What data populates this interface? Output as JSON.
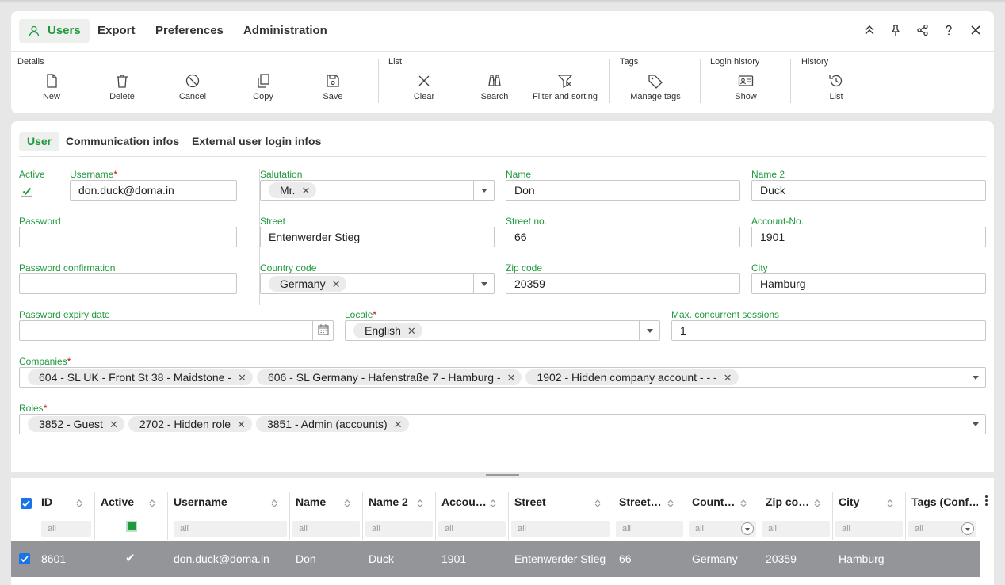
{
  "menu": {
    "items": [
      "Users",
      "Export",
      "Preferences",
      "Administration"
    ],
    "window_icons": [
      "collapse-up-icon",
      "pin-icon",
      "share-icon",
      "help-icon",
      "close-icon"
    ]
  },
  "toolbar": {
    "groups": {
      "details": "Details",
      "list": "List",
      "tags": "Tags",
      "login_history": "Login history",
      "history": "History"
    },
    "buttons": {
      "new": "New",
      "delete": "Delete",
      "cancel": "Cancel",
      "copy": "Copy",
      "save": "Save",
      "clear": "Clear",
      "search": "Search",
      "filter": "Filter and sorting",
      "manage_tags": "Manage tags",
      "show": "Show",
      "list": "List"
    }
  },
  "tabs": [
    "User",
    "Communication infos",
    "External user login infos"
  ],
  "form": {
    "active_label": "Active",
    "active_checked": true,
    "username_label": "Username",
    "username": "don.duck@doma.in",
    "password_label": "Password",
    "password": "",
    "password_confirm_label": "Password confirmation",
    "password_confirm": "",
    "salutation_label": "Salutation",
    "salutation": "Mr.",
    "name_label": "Name",
    "name": "Don",
    "name2_label": "Name 2",
    "name2": "Duck",
    "street_label": "Street",
    "street": "Entenwerder Stieg",
    "street_no_label": "Street no.",
    "street_no": "66",
    "account_no_label": "Account-No.",
    "account_no": "1901",
    "country_label": "Country code",
    "country": "Germany",
    "zip_label": "Zip code",
    "zip": "20359",
    "city_label": "City",
    "city": "Hamburg",
    "expiry_label": "Password expiry date",
    "expiry": "",
    "locale_label": "Locale",
    "locale": "English",
    "sessions_label": "Max. concurrent sessions",
    "sessions": "1",
    "companies_label": "Companies",
    "companies": [
      "604 - SL UK - Front St 38 - Maidstone -",
      "606 - SL Germany - Hafenstraße 7 - Hamburg -",
      "1902 - Hidden company account - - -"
    ],
    "roles_label": "Roles",
    "roles": [
      "3852 - Guest",
      "2702 - Hidden role",
      "3851 - Admin (accounts)"
    ],
    "required_mark": "*",
    "chip_remove": "✕"
  },
  "grid": {
    "columns": [
      "ID",
      "Active",
      "Username",
      "Name",
      "Name 2",
      "Accou…",
      "Street",
      "Street…",
      "Count…",
      "Zip co…",
      "City",
      "Tags (Conf…"
    ],
    "filter_placeholder": "all",
    "row": {
      "checked": true,
      "id": "8601",
      "active": "✔",
      "username": "don.duck@doma.in",
      "name": "Don",
      "name2": "Duck",
      "account": "1901",
      "street": "Entenwerder Stieg",
      "street_no": "66",
      "country": "Germany",
      "zip": "20359",
      "city": "Hamburg",
      "tags": ""
    }
  },
  "colors": {
    "accent": "#1e9a3c",
    "required": "#d0021b",
    "row_selected": "#939598",
    "checkbox_blue": "#1a73e8"
  }
}
